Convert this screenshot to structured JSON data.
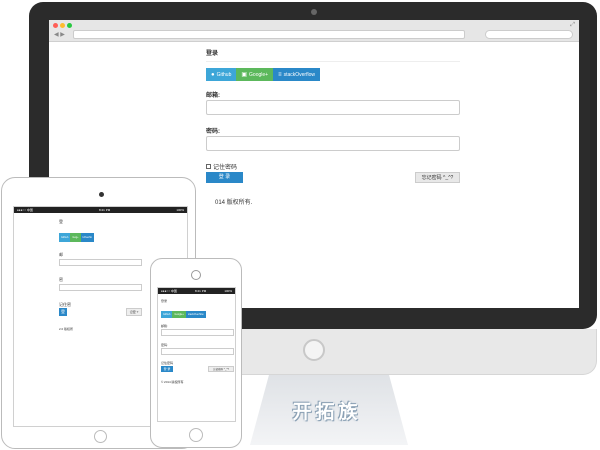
{
  "desktop": {
    "form": {
      "title": "登录",
      "email_label": "邮箱:",
      "password_label": "密码:",
      "remember_label": "记住密码",
      "login_button": "登 录",
      "forgot_button": "忘记密码 ^_^?",
      "copyright": "014 版权所有."
    },
    "social": [
      {
        "label": "Github",
        "icon": "github-icon",
        "color": "#3da6d8"
      },
      {
        "label": "Google+",
        "icon": "google-plus-icon",
        "color": "#5cb85c"
      },
      {
        "label": "stackOverflow",
        "icon": "stackoverflow-icon",
        "color": "#2a88c8"
      }
    ]
  },
  "tablet": {
    "status": {
      "carrier": "●●●○○ 中国",
      "time": "8:21 PM",
      "battery": "100%"
    },
    "title": "登",
    "social": [
      "Github",
      "Gog+",
      "kOverflo"
    ],
    "email_label": "邮",
    "password_label": "密",
    "remember_label": "记住密",
    "login_button": "登",
    "forgot_button": "记密 ?",
    "copyright": "2.0 版权所"
  },
  "phone": {
    "status": {
      "carrier": "●●●○○ 中国",
      "time": "8:21 PM",
      "battery": "100%"
    },
    "title": "登录",
    "social": [
      "Github",
      "Google+",
      "stackOverflow"
    ],
    "email_label": "邮箱:",
    "password_label": "密码:",
    "remember_label": "记住密码",
    "login_button": "登 录",
    "forgot_button": "忘记密码 ^_^?",
    "copyright": "© 2014 版权所有."
  },
  "brand": "开拓族",
  "colors": {
    "accent": "#2a88c8",
    "github": "#3da6d8",
    "google": "#5cb85c",
    "bezel": "#2b2b2b"
  }
}
